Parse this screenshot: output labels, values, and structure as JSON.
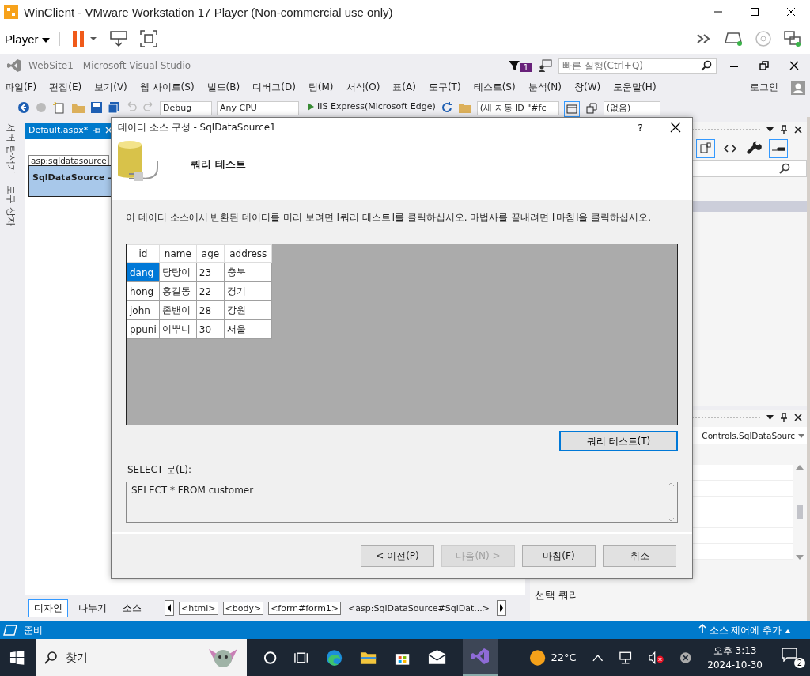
{
  "vm_window": {
    "title": "WinClient - VMware Workstation 17 Player (Non-commercial use only)",
    "player_menu": "Player"
  },
  "vs": {
    "title": "WebSite1 - Microsoft Visual Studio",
    "notification_count": "1",
    "quick_launch": {
      "placeholder": "빠른 실행(Ctrl+Q)"
    },
    "menu": [
      "파일(F)",
      "편집(E)",
      "보기(V)",
      "웹 사이트(S)",
      "빌드(B)",
      "디버그(D)",
      "팀(M)",
      "서식(O)",
      "표(A)",
      "도구(T)",
      "테스트(S)",
      "분석(N)",
      "창(W)",
      "도움말(H)"
    ],
    "login": "로그인",
    "toolbar": {
      "configuration": "Debug",
      "platform": "Any CPU",
      "run": "IIS Express(Microsoft Edge)",
      "target": "(새 자동 ID \"#fc",
      "style": "(없음)"
    }
  },
  "side_tabs": [
    "서버 탐색기",
    "도구 상자"
  ],
  "document": {
    "tab": "Default.aspx*",
    "control_tag": "asp:sqldatasource",
    "control_label": "SqlDataSource -",
    "views": [
      {
        "label": "디자인",
        "selected": true
      },
      {
        "label": "나누기",
        "selected": false
      },
      {
        "label": "소스",
        "selected": false
      }
    ],
    "breadcrumbs": [
      "<html>",
      "<body>",
      "<form#form1>",
      "<asp:SqlDataSource#SqlDat...>"
    ]
  },
  "properties": {
    "object": "Controls.SqlDataSourc",
    "description": "선택 쿼리"
  },
  "dialog": {
    "title": "데이터 소스 구성 - SqlDataSource1",
    "help": "?",
    "heading": "쿼리 테스트",
    "instruction": "이 데이터 소스에서 반환된 데이터를 미리 보려면 [쿼리 테스트]를 클릭하십시오. 마법사를 끝내려면 [마침]을 클릭하십시오.",
    "grid": {
      "columns": [
        "id",
        "name",
        "age",
        "address"
      ],
      "rows": [
        {
          "cells": [
            "dang",
            "당탕이",
            "23",
            "충북"
          ],
          "selected": true
        },
        {
          "cells": [
            "hong",
            "홍길동",
            "22",
            "경기"
          ],
          "selected": false
        },
        {
          "cells": [
            "john",
            "존밴이",
            "28",
            "강원"
          ],
          "selected": false
        },
        {
          "cells": [
            "ppuni",
            "이뿌니",
            "30",
            "서울"
          ],
          "selected": false
        }
      ]
    },
    "test_button": "쿼리 테스트(T)",
    "sql_label": "SELECT 문(L):",
    "sql": "SELECT * FROM customer",
    "buttons": [
      {
        "label": "< 이전(P)",
        "disabled": false
      },
      {
        "label": "다음(N) >",
        "disabled": true
      },
      {
        "label": "마침(F)",
        "disabled": false
      },
      {
        "label": "취소",
        "disabled": false
      }
    ]
  },
  "status_bar": {
    "text": "준비",
    "source_control": "소스 제어에 추가"
  },
  "taskbar": {
    "search": "찾기",
    "weather": "22°C",
    "time": "오후 3:13",
    "date": "2024-10-30",
    "notifications": "2"
  }
}
